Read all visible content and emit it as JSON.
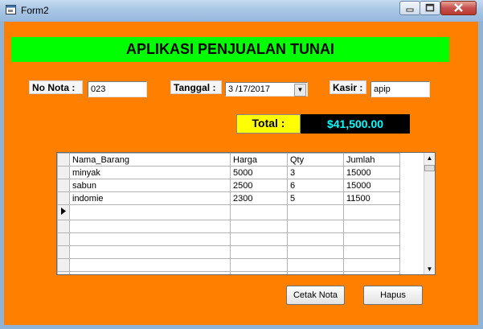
{
  "window": {
    "title": "Form2"
  },
  "header": {
    "title": "APLIKASI PENJUALAN TUNAI"
  },
  "form": {
    "no_nota_label": "No Nota :",
    "no_nota_value": "023",
    "tanggal_label": "Tanggal :",
    "tanggal_value": "3 /17/2017",
    "kasir_label": "Kasir :",
    "kasir_value": "apip"
  },
  "total": {
    "label": "Total :",
    "value": "$41,500.00"
  },
  "grid": {
    "columns": [
      "Nama_Barang",
      "Harga",
      "Qty",
      "Jumlah"
    ],
    "rows": [
      [
        "minyak",
        "5000",
        "3",
        "15000"
      ],
      [
        "sabun",
        "2500",
        "6",
        "15000"
      ],
      [
        "indomie",
        "2300",
        "5",
        "11500"
      ]
    ]
  },
  "buttons": {
    "print": "Cetak Nota",
    "clear": "Hapus"
  },
  "colors": {
    "form_bg": "#ff7f00",
    "banner_bg": "#00ff00",
    "total_label_bg": "#ffff00",
    "total_value_bg": "#000000",
    "total_value_fg": "#00ffff"
  },
  "icons": {
    "app": "form-app-icon",
    "minimize": "minimize-icon",
    "maximize": "maximize-icon",
    "close": "close-icon"
  }
}
